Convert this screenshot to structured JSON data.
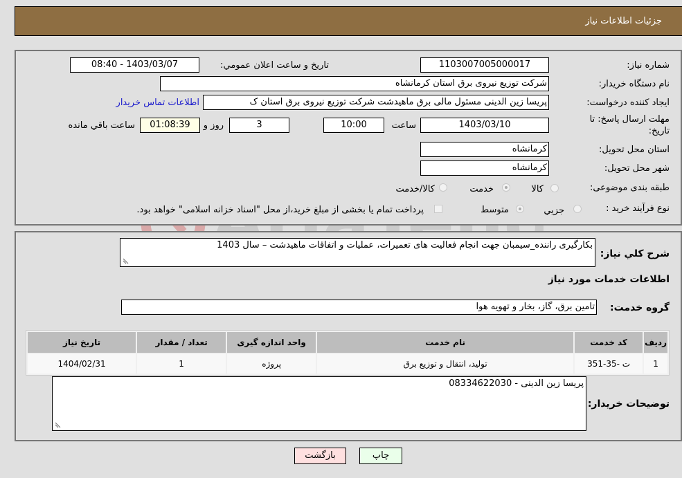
{
  "header": {
    "title": "جزئیات اطلاعات نیاز"
  },
  "form": {
    "need_number": {
      "label": "شماره نیاز:",
      "value": "1103007005000017"
    },
    "announce_datetime": {
      "label": "تاریخ و ساعت اعلان عمومي:",
      "value": "1403/03/07 - 08:40"
    },
    "buyer_org": {
      "label": "نام دستگاه خریدار:",
      "value": "شرکت توزیع نیروی برق استان کرمانشاه"
    },
    "creator": {
      "label": "ایجاد کننده درخواست:",
      "value": "پریسا زین الدینی مسئول مالی برق ماهیدشت شرکت توزیع نیروی برق استان ک"
    },
    "contact_link": "اطلاعات تماس خریدار",
    "deadline": {
      "label_line1": "مهلت ارسال پاسخ: تا",
      "label_line2": "تاریخ:",
      "date": "1403/03/10",
      "time_label": "ساعت",
      "time": "10:00",
      "days": "3",
      "days_label": "روز و",
      "remaining": "01:08:39",
      "remaining_label": "ساعت باقي مانده"
    },
    "province": {
      "label": "استان محل تحویل:",
      "value": "کرمانشاه"
    },
    "city": {
      "label": "شهر محل تحویل:",
      "value": "کرمانشاه"
    },
    "category": {
      "label": "طبقه بندی موضوعی:",
      "options": [
        "کالا",
        "خدمت",
        "کالا/خدمت"
      ],
      "selected": "خدمت"
    },
    "purchase_type": {
      "label": "نوع فرآیند خرید :",
      "options": [
        "جزيي",
        "متوسط"
      ],
      "selected": "متوسط",
      "treasury_note": "پرداخت تمام یا بخشی از مبلغ خرید،از محل \"اسناد خزانه اسلامی\" خواهد بود."
    }
  },
  "description": {
    "label": "شرح کلي نياز:",
    "value": "بکارگیری راننده_سیمبان جهت انجام فعالیت های تعمیرات، عملیات و اتفاقات ماهیدشت – سال 1403"
  },
  "services_section": {
    "title": "اطلاعات خدمات مورد نیاز",
    "group_label": "گروه خدمت:",
    "group_value": "تامین برق، گاز، بخار و تهویه هوا"
  },
  "table": {
    "headers": [
      "ردیف",
      "کد خدمت",
      "نام خدمت",
      "واحد اندازه گیری",
      "تعداد / مقدار",
      "تاریخ نیاز"
    ],
    "rows": [
      [
        "1",
        "ت -35-351",
        "تولید، انتقال و توزیع برق",
        "پروژه",
        "1",
        "1404/02/31"
      ]
    ]
  },
  "buyer_notes": {
    "label": "توضیحات خریدار:",
    "value": "پریسا زین الدینی - 08334622030"
  },
  "buttons": {
    "print": "چاپ",
    "back": "بازگشت"
  },
  "colors": {
    "header_bg": "#8e6e42",
    "print_bg": "#eaffea",
    "back_bg": "#ffe0e0",
    "link": "#1a1acc"
  }
}
